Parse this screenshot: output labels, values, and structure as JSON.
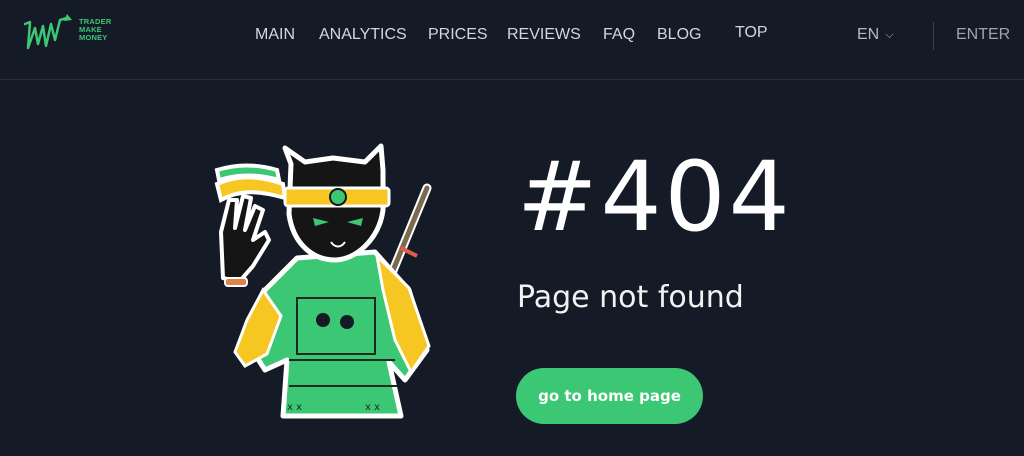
{
  "brand": {
    "logo_lines": [
      "TRADER",
      "MAKE",
      "MONEY"
    ],
    "accent": "#3cc774"
  },
  "nav": {
    "items": [
      {
        "label": "MAIN"
      },
      {
        "label": "ANALYTICS"
      },
      {
        "label": "PRICES"
      },
      {
        "label": "REVIEWS"
      },
      {
        "label": "FAQ"
      },
      {
        "label": "BLOG"
      },
      {
        "label": "TOP"
      }
    ],
    "language": "EN",
    "enter_label": "ENTER"
  },
  "error": {
    "code": "#404",
    "message": "Page not found",
    "button_label": "go to home page"
  },
  "colors": {
    "background": "#151a27",
    "button": "#3cc774"
  },
  "icons": {
    "logo": "tmm-chart-logo-icon",
    "language_toggle": "chevron-down-icon",
    "mascot": "samurai-cat-illustration"
  }
}
